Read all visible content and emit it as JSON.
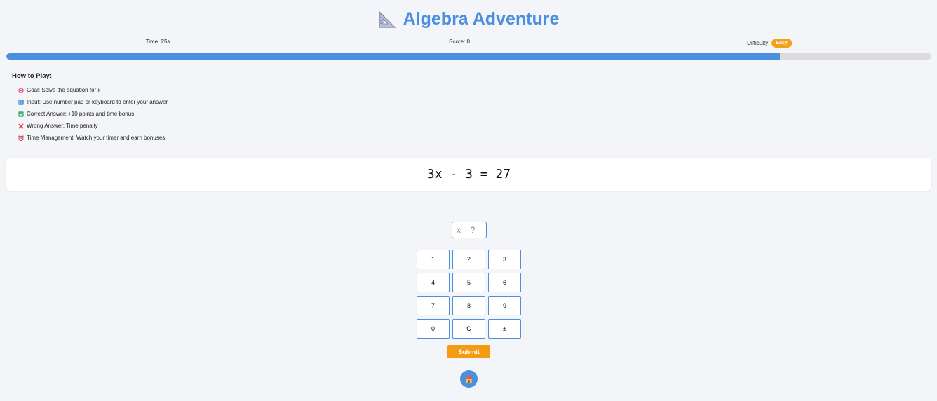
{
  "header": {
    "title": "Algebra Adventure",
    "title_icon": "triangular-ruler-icon"
  },
  "stats": {
    "time": "Time: 25s",
    "score": "Score: 0",
    "difficulty_label": "Difficulty:",
    "difficulty_value": "Easy"
  },
  "progress": {
    "fraction": 0.836
  },
  "how_to_play": {
    "heading": "How to Play:",
    "items": [
      {
        "icon": "target-icon",
        "text": "Goal: Solve the equation for x"
      },
      {
        "icon": "keypad-icon",
        "text": "Input: Use number pad or keyboard to enter your answer"
      },
      {
        "icon": "check-icon",
        "text": "Correct Answer: +10 points and time bonus"
      },
      {
        "icon": "cross-icon",
        "text": "Wrong Answer: Time penalty"
      },
      {
        "icon": "alarm-clock-icon",
        "text": "Time Management: Watch your timer and earn bonuses!"
      }
    ]
  },
  "equation": "3x - 3 = 27",
  "answer": {
    "placeholder": "x = ?",
    "value": ""
  },
  "keypad": [
    "1",
    "2",
    "3",
    "4",
    "5",
    "6",
    "7",
    "8",
    "9",
    "0",
    "C",
    "±"
  ],
  "submit_label": "Submit",
  "home_icon": "house-icon",
  "colors": {
    "accent": "#4a8fe0",
    "orange": "#f39c12",
    "background": "#f4f5f9"
  }
}
